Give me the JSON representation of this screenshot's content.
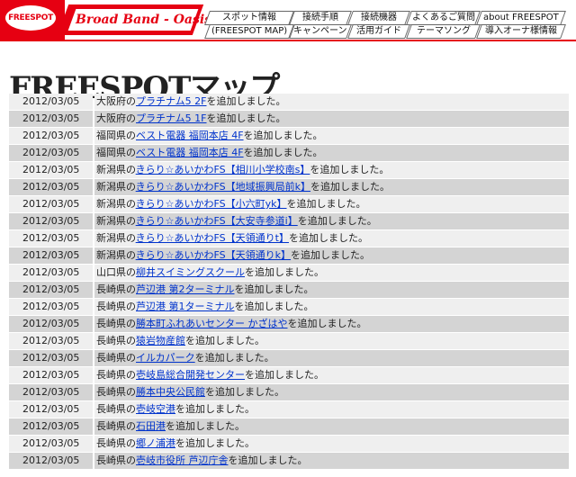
{
  "logo": {
    "text": "FREESPOT"
  },
  "banner": {
    "text": "Broad Band - Oasis"
  },
  "nav": [
    {
      "label": "スポット情報"
    },
    {
      "label": "接続手順"
    },
    {
      "label": "接続機器"
    },
    {
      "label": "よくあるご質問"
    },
    {
      "label": "about FREESPOT"
    },
    {
      "label": "(FREESPOT MAP)"
    },
    {
      "label": "キャンペーン"
    },
    {
      "label": "活用ガイド"
    },
    {
      "label": "テーマソング"
    },
    {
      "label": "導入オーナ様情報"
    }
  ],
  "page": {
    "title": "FREESPOTマップ"
  },
  "colors": {
    "accent": "#e60012",
    "link": "#0033cc",
    "row_dark": "#d4d4d4",
    "row_light": "#efefef"
  },
  "entries": [
    {
      "date": "2012/03/05",
      "prefix": "大阪府の",
      "link": "プラチナム5 2F",
      "suffix": "を追加しました。"
    },
    {
      "date": "2012/03/05",
      "prefix": "大阪府の",
      "link": "プラチナム5 1F",
      "suffix": "を追加しました。"
    },
    {
      "date": "2012/03/05",
      "prefix": "福岡県の",
      "link": "ベスト電器 福岡本店 4F",
      "suffix": "を追加しました。"
    },
    {
      "date": "2012/03/05",
      "prefix": "福岡県の",
      "link": "ベスト電器 福岡本店 4F",
      "suffix": "を追加しました。"
    },
    {
      "date": "2012/03/05",
      "prefix": "新潟県の",
      "link": "きらり☆あいかわFS【相川小学校南s】",
      "suffix": "を追加しました。"
    },
    {
      "date": "2012/03/05",
      "prefix": "新潟県の",
      "link": "きらり☆あいかわFS【地域振興局前k】",
      "suffix": "を追加しました。"
    },
    {
      "date": "2012/03/05",
      "prefix": "新潟県の",
      "link": "きらり☆あいかわFS【小六町yk】",
      "suffix": "を追加しました。"
    },
    {
      "date": "2012/03/05",
      "prefix": "新潟県の",
      "link": "きらり☆あいかわFS【大安寺参道i】",
      "suffix": "を追加しました。"
    },
    {
      "date": "2012/03/05",
      "prefix": "新潟県の",
      "link": "きらり☆あいかわFS【天領通りt】",
      "suffix": "を追加しました。"
    },
    {
      "date": "2012/03/05",
      "prefix": "新潟県の",
      "link": "きらり☆あいかわFS【天領通りk】",
      "suffix": "を追加しました。"
    },
    {
      "date": "2012/03/05",
      "prefix": "山口県の",
      "link": "柳井スイミングスクール",
      "suffix": "を追加しました。"
    },
    {
      "date": "2012/03/05",
      "prefix": "長崎県の",
      "link": "芦辺港 第2ターミナル",
      "suffix": "を追加しました。"
    },
    {
      "date": "2012/03/05",
      "prefix": "長崎県の",
      "link": "芦辺港 第1ターミナル",
      "suffix": "を追加しました。"
    },
    {
      "date": "2012/03/05",
      "prefix": "長崎県の",
      "link": "勝本町ふれあいセンター かざはや",
      "suffix": "を追加しました。"
    },
    {
      "date": "2012/03/05",
      "prefix": "長崎県の",
      "link": "猿岩物産館",
      "suffix": "を追加しました。"
    },
    {
      "date": "2012/03/05",
      "prefix": "長崎県の",
      "link": "イルカパーク",
      "suffix": "を追加しました。"
    },
    {
      "date": "2012/03/05",
      "prefix": "長崎県の",
      "link": "壱岐島総合開発センター",
      "suffix": "を追加しました。"
    },
    {
      "date": "2012/03/05",
      "prefix": "長崎県の",
      "link": "勝本中央公民館",
      "suffix": "を追加しました。"
    },
    {
      "date": "2012/03/05",
      "prefix": "長崎県の",
      "link": "壱岐空港",
      "suffix": "を追加しました。"
    },
    {
      "date": "2012/03/05",
      "prefix": "長崎県の",
      "link": "石田港",
      "suffix": "を追加しました。"
    },
    {
      "date": "2012/03/05",
      "prefix": "長崎県の",
      "link": "郷ノ浦港",
      "suffix": "を追加しました。"
    },
    {
      "date": "2012/03/05",
      "prefix": "長崎県の",
      "link": "壱岐市役所 芦辺庁舎",
      "suffix": "を追加しました。"
    }
  ]
}
